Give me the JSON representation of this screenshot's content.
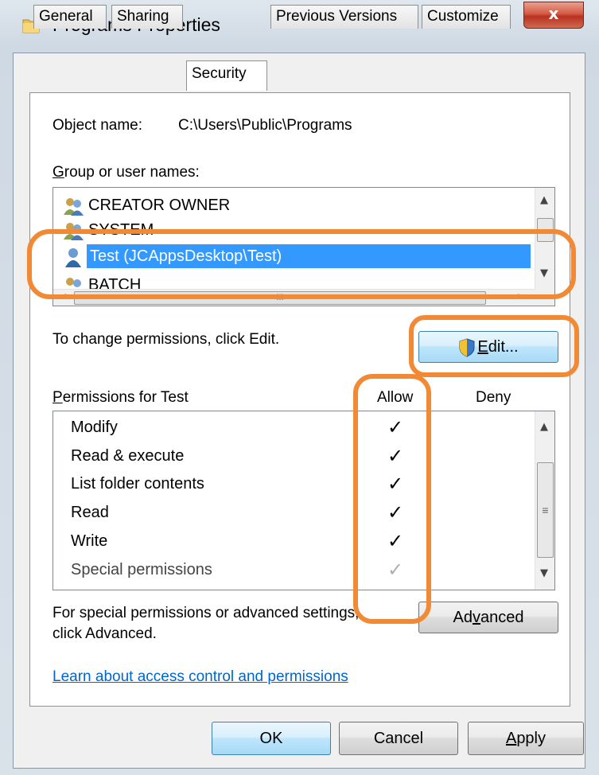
{
  "window": {
    "title": "Programs Properties",
    "close_symbol": "x",
    "icon": "folder-icon"
  },
  "tabs": [
    {
      "label": "General"
    },
    {
      "label": "Sharing"
    },
    {
      "label": "Security"
    },
    {
      "label": "Previous Versions"
    },
    {
      "label": "Customize"
    }
  ],
  "object": {
    "label": "Object name:",
    "value": "C:\\Users\\Public\\Programs"
  },
  "groups": {
    "label_prefix": "G",
    "label_rest": "roup or user names:",
    "users": [
      {
        "name": "CREATOR OWNER",
        "icon": "group-icon"
      },
      {
        "name": "SYSTEM",
        "icon": "group-icon"
      },
      {
        "name": "Test (JCAppsDesktop\\Test)",
        "icon": "user-icon"
      },
      {
        "name": "BATCH",
        "icon": "group-icon"
      }
    ],
    "hscroll_grip": "III"
  },
  "change_hint": "To change permissions, click Edit.",
  "edit_button": {
    "prefix": "",
    "underlined": "E",
    "rest": "dit..."
  },
  "permissions": {
    "label_underlined": "P",
    "label_rest": "ermissions for Test",
    "allow_header": "Allow",
    "deny_header": "Deny",
    "rows": [
      {
        "name": "Modify",
        "allow": "✓"
      },
      {
        "name": "Read & execute",
        "allow": "✓"
      },
      {
        "name": "List folder contents",
        "allow": "✓"
      },
      {
        "name": "Read",
        "allow": "✓"
      },
      {
        "name": "Write",
        "allow": "✓"
      },
      {
        "name": "Special permissions",
        "allow": "✓"
      }
    ],
    "scroll_grip": "≡"
  },
  "advanced": {
    "line1": "For special permissions or advanced settings,",
    "line2": "click Advanced.",
    "button_prefix": "Ad",
    "button_underlined": "v",
    "button_rest": "anced"
  },
  "learn_link": "Learn about access control and permissions",
  "footer": {
    "ok": "OK",
    "cancel": "Cancel",
    "apply_underlined": "A",
    "apply_rest": "pply"
  },
  "colors": {
    "annotation": "#f28a35",
    "selection": "#3399ff",
    "link": "#0066cc"
  }
}
